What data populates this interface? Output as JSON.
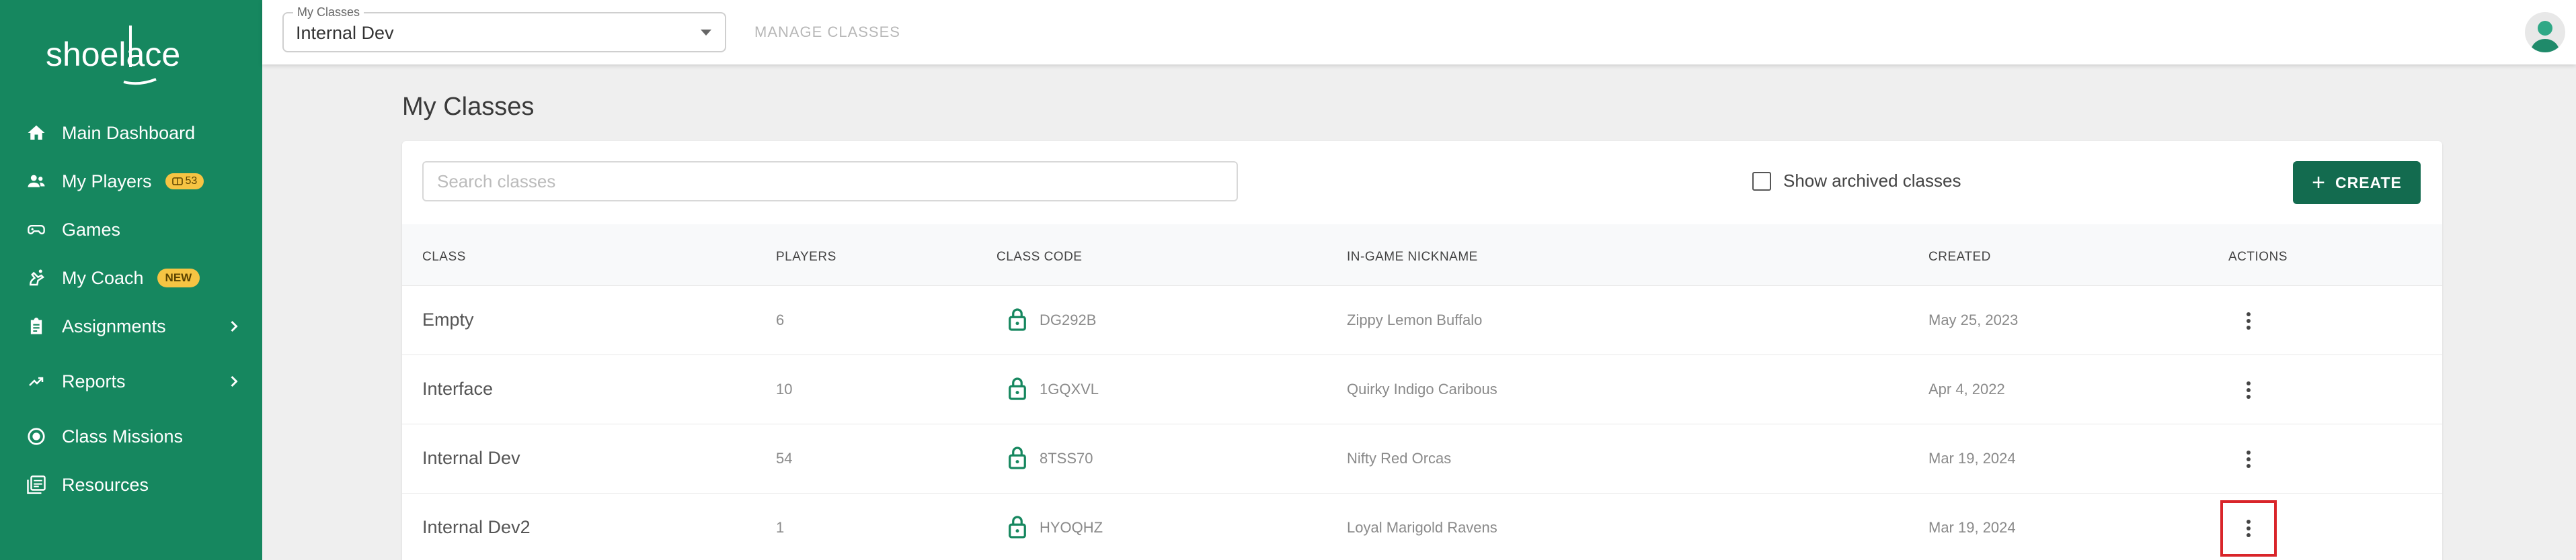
{
  "brand": {
    "logo_text": "shoelace",
    "accent": "#16875f",
    "button_color": "#136b4f",
    "badge_color": "#f6c443"
  },
  "sidebar": {
    "items": [
      {
        "label": "Main Dashboard",
        "icon": "home-icon"
      },
      {
        "label": "My Players",
        "icon": "players-icon",
        "badge": "53"
      },
      {
        "label": "Games",
        "icon": "gamepad-icon"
      },
      {
        "label": "My Coach",
        "icon": "coach-icon",
        "badge": "NEW"
      },
      {
        "label": "Assignments",
        "icon": "clipboard-icon",
        "has_children": true
      },
      {
        "label": "Reports",
        "icon": "trending-up-icon",
        "has_children": true
      },
      {
        "label": "Class Missions",
        "icon": "badge-icon"
      },
      {
        "label": "Resources",
        "icon": "library-icon"
      }
    ]
  },
  "topbar": {
    "select_legend": "My Classes",
    "select_value": "Internal Dev",
    "manage_label": "MANAGE CLASSES"
  },
  "main": {
    "title": "My Classes",
    "search_placeholder": "Search classes",
    "archived_label": "Show archived classes",
    "create_label": "CREATE",
    "columns": [
      "CLASS",
      "PLAYERS",
      "CLASS CODE",
      "IN-GAME NICKNAME",
      "CREATED",
      "ACTIONS"
    ],
    "rows": [
      {
        "name": "Empty",
        "players": "6",
        "code": "DG292B",
        "nickname": "Zippy Lemon Buffalo",
        "created": "May 25, 2023"
      },
      {
        "name": "Interface",
        "players": "10",
        "code": "1GQXVL",
        "nickname": "Quirky Indigo Caribous",
        "created": "Apr 4, 2022"
      },
      {
        "name": "Internal Dev",
        "players": "54",
        "code": "8TSS70",
        "nickname": "Nifty Red Orcas",
        "created": "Mar 19, 2024"
      },
      {
        "name": "Internal Dev2",
        "players": "1",
        "code": "HYOQHZ",
        "nickname": "Loyal Marigold Ravens",
        "created": "Mar 19, 2024"
      }
    ]
  }
}
